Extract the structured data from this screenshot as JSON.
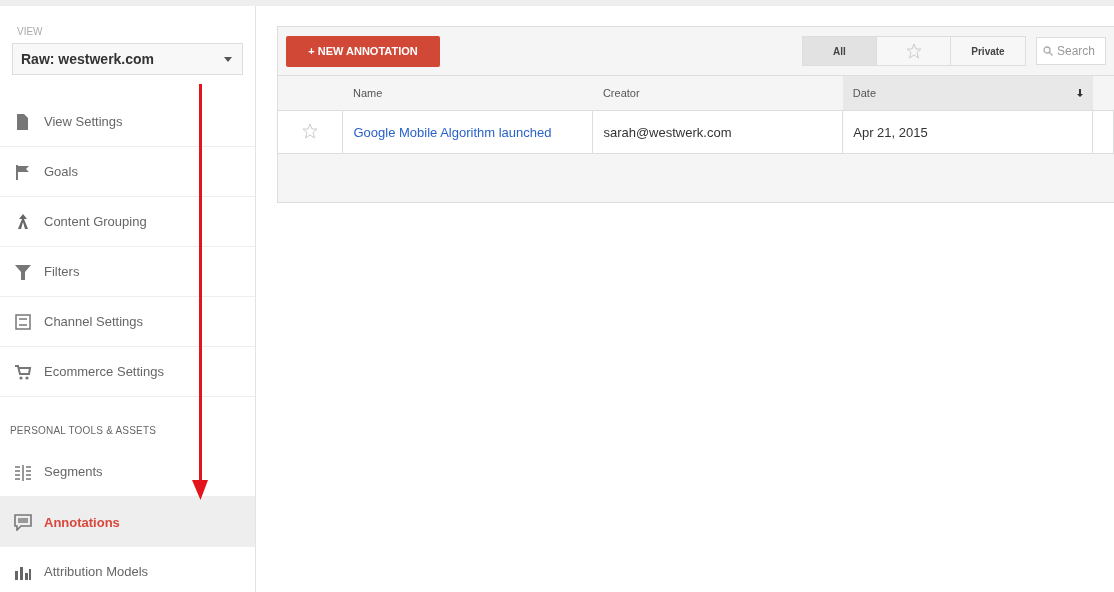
{
  "sidebar": {
    "view_label": "VIEW",
    "view_select": "Raw: westwerk.com",
    "items": [
      {
        "label": "View Settings",
        "selected": false
      },
      {
        "label": "Goals",
        "selected": false
      },
      {
        "label": "Content Grouping",
        "selected": false
      },
      {
        "label": "Filters",
        "selected": false
      },
      {
        "label": "Channel Settings",
        "selected": false
      },
      {
        "label": "Ecommerce Settings",
        "selected": false
      }
    ],
    "section_title": "PERSONAL TOOLS & ASSETS",
    "personal_items": [
      {
        "label": "Segments",
        "selected": false
      },
      {
        "label": "Annotations",
        "selected": true
      },
      {
        "label": "Attribution Models",
        "selected": false
      }
    ]
  },
  "toolbar": {
    "new_button": "+ NEW ANNOTATION",
    "filters": [
      {
        "kind": "text",
        "label": "All",
        "selected": true
      },
      {
        "kind": "star",
        "selected": false
      },
      {
        "kind": "text",
        "label": "Private",
        "selected": false
      }
    ],
    "search": {
      "placeholder": "Search"
    }
  },
  "table": {
    "columns": [
      {
        "label": "Name",
        "sorted": false
      },
      {
        "label": "Creator",
        "sorted": false
      },
      {
        "label": "Date",
        "sorted": true
      }
    ],
    "rows": [
      {
        "starred": false,
        "name": "Google Mobile Algorithm launched",
        "creator": "sarah@westwerk.com",
        "date": "Apr 21, 2015"
      }
    ]
  }
}
